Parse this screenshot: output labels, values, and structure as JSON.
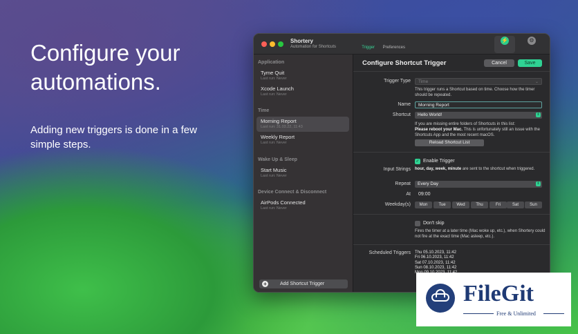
{
  "hero": {
    "title": "Configure your automations.",
    "subtitle": "Adding new triggers is done in a few simple steps."
  },
  "window": {
    "app_name": "Shortery",
    "app_subtitle": "Automation for Shortcuts",
    "toolbar_tabs": [
      {
        "label": "Trigger",
        "icon": "bolt-icon",
        "active": true
      },
      {
        "label": "Preferences",
        "icon": "gear-icon",
        "active": false
      }
    ]
  },
  "sidebar": {
    "sections": [
      {
        "title": "Application",
        "items": [
          {
            "name": "Tyme Quit",
            "last_run": "Last run: Never"
          },
          {
            "name": "Xcode Launch",
            "last_run": "Last run: Never"
          }
        ]
      },
      {
        "title": "Time",
        "items": [
          {
            "name": "Morning Report",
            "last_run": "Last run: 31.03.22, 11:43",
            "selected": true
          },
          {
            "name": "Weekly Report",
            "last_run": "Last run: Never"
          }
        ]
      },
      {
        "title": "Wake Up & Sleep",
        "items": [
          {
            "name": "Start Music",
            "last_run": "Last run: Never"
          }
        ]
      },
      {
        "title": "Device Connect & Disconnect",
        "items": [
          {
            "name": "AirPods Connected",
            "last_run": "Last run: Never"
          }
        ]
      }
    ],
    "add_button": "Add Shortcut Trigger"
  },
  "main": {
    "title": "Configure Shortcut Trigger",
    "cancel_label": "Cancel",
    "save_label": "Save",
    "trigger_type_label": "Trigger Type",
    "trigger_type_value": "Time",
    "trigger_type_desc": "This trigger runs a Shortcut based on time. Choose how the timer should be repeated.",
    "name_label": "Name",
    "name_value": "Morning Report",
    "shortcut_label": "Shortcut",
    "shortcut_value": "Hello World!",
    "missing_note_1": "If you are missing entire folders of Shortcuts in this list:",
    "missing_note_2": "Please reboot your Mac.",
    "missing_note_3": " This is unfortunately still an issue with the Shortcuts App and the most recent macOS.",
    "reload_label": "Reload Shortcut List",
    "enable_label": "Enable Trigger",
    "input_strings_label": "Input Strings",
    "input_strings_bold": "hour, day, week, minute",
    "input_strings_rest": " are sent to the shortcut when triggered.",
    "repeat_label": "Repeat",
    "repeat_value": "Every Day",
    "at_label": "At",
    "at_value": "09:00",
    "weekdays_label": "Weekday(s)",
    "weekdays": [
      "Mon",
      "Tue",
      "Wed",
      "Thu",
      "Fri",
      "Sat",
      "Sun"
    ],
    "dont_skip_label": "Don't skip",
    "dont_skip_desc": "Fires the timer at a later time (Mac woke up, etc.), when Shortery could not fire at the exact time (Mac asleep, etc.).",
    "scheduled_label": "Scheduled Triggers",
    "scheduled": [
      "Thu 05.10.2023, 11:42",
      "Fri 06.10.2023, 11:42",
      "Sat 07.10.2023, 11:42",
      "Sun 08.10.2023, 11:42",
      "Mon 09.10.2023, 11:42"
    ]
  },
  "watermark": {
    "name": "FileGit",
    "tagline": "Free & Unlimited"
  },
  "colors": {
    "accent": "#2fd293",
    "window_bg": "#2b2b2d",
    "sidebar_bg": "#353234",
    "watermark_blue": "#1f3a74"
  }
}
